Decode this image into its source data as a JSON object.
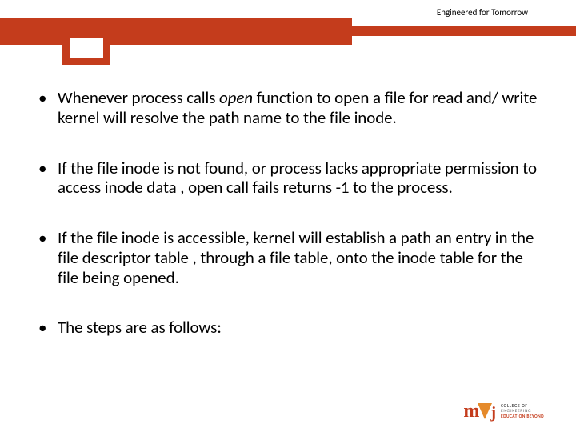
{
  "header": {
    "tagline": "Engineered for Tomorrow",
    "accent_color": "#c43c1c",
    "notch_accent": "#c43c1c"
  },
  "bullets": [
    {
      "pre": "Whenever process calls ",
      "ital": "open",
      "post": " function to open a file for read and/ write kernel will resolve the path name to the file inode."
    },
    {
      "text": "If the file inode is not found, or process lacks appropriate permission to access inode data , open call fails returns -1 to the process."
    },
    {
      "text": "If the file inode is accessible, kernel will establish a path an entry in the file descriptor table , through a file table, onto the inode table for the file being opened."
    },
    {
      "text": "The steps are as follows:"
    }
  ],
  "logo": {
    "mark_m": "m",
    "mark_j": "j",
    "line1": "COLLEGE OF",
    "line2": "ENGINEERING",
    "line3": "EDUCATION BEYOND"
  }
}
